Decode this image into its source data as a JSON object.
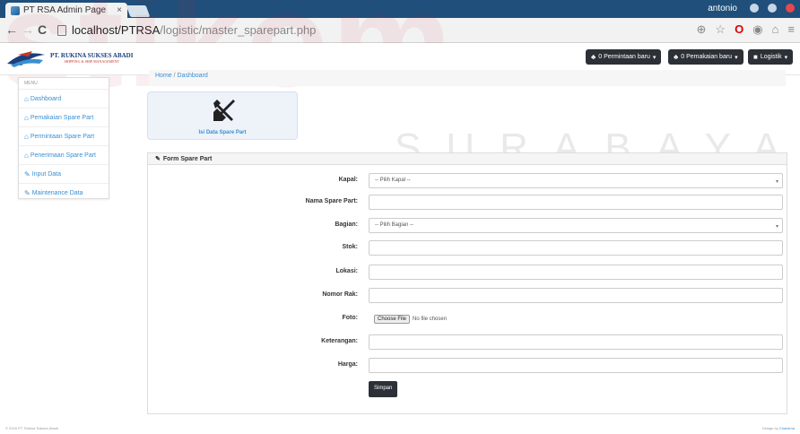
{
  "browser": {
    "tab_title": "PT RSA Admin Page",
    "tab_close": "×",
    "user": "antonio",
    "url_host": "localhost/PTRSA",
    "url_path": "/logistic/master_sparepart.php"
  },
  "brand": {
    "name": "PT. RUKINA SUKSES ABADI",
    "tagline": "SHIPPING & SHIP MANAGEMENT"
  },
  "topbar": {
    "permintaan_label": "0 Permintaan baru",
    "pemakaian_label": "0 Pemakaian baru",
    "logistik_label": "Logistik"
  },
  "sidebar": {
    "heading": "MENU",
    "items": [
      {
        "label": "Dashboard",
        "icon": "home-icon"
      },
      {
        "label": "Pemakaian Spare Part",
        "icon": "home-icon"
      },
      {
        "label": "Permintaan Spare Part",
        "icon": "home-icon"
      },
      {
        "label": "Penerimaan Spare Part",
        "icon": "home-icon"
      },
      {
        "label": "Input Data",
        "icon": "edit-icon"
      },
      {
        "label": "Maintenance Data",
        "icon": "edit-icon"
      }
    ]
  },
  "breadcrumb": {
    "home": "Home",
    "sep": "/",
    "current": "Dashboard"
  },
  "tile": {
    "label": "Isi Data Spare Part",
    "icon": "tools-icon"
  },
  "form": {
    "title": "Form Spare Part",
    "fields": [
      {
        "label": "Kapal:",
        "value": "-- Pilih Kapal --",
        "type": "select"
      },
      {
        "label": "Nama Spare Part:",
        "value": "",
        "type": "text"
      },
      {
        "label": "Bagian:",
        "value": "-- Pilih Bagian --",
        "type": "select"
      },
      {
        "label": "Stok:",
        "value": "",
        "type": "text"
      },
      {
        "label": "Lokasi:",
        "value": "",
        "type": "text"
      },
      {
        "label": "Nomor Rak:",
        "value": "",
        "type": "text"
      },
      {
        "label": "Foto:",
        "value": "No file chosen",
        "button": "Choose File",
        "type": "file"
      },
      {
        "label": "Keterangan:",
        "value": "",
        "type": "text"
      },
      {
        "label": "Harga:",
        "value": "",
        "type": "text"
      }
    ],
    "submit_label": "Simpan"
  },
  "footer": {
    "copyright": "© 2016 PT. Rukina Sukses Abadi",
    "design_prefix": "Design by",
    "design_link": "Charisma"
  },
  "watermark": {
    "main": "stikom",
    "sub": "SURABAYA"
  },
  "colors": {
    "accent": "#3a8fd2",
    "dark_button": "#2c3037",
    "chrome_title": "#1f4f7a"
  }
}
